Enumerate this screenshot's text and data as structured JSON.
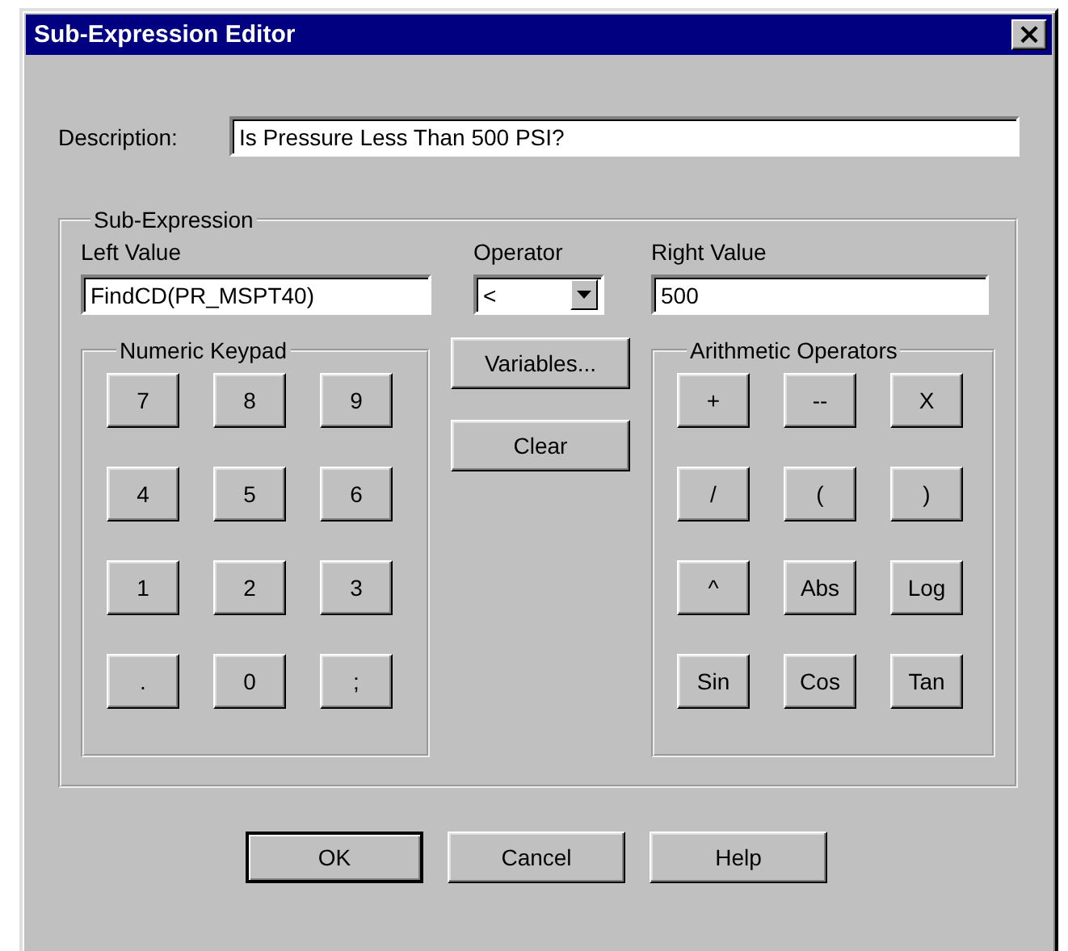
{
  "window": {
    "title": "Sub-Expression Editor",
    "close": "×"
  },
  "description": {
    "label": "Description:",
    "value": "Is Pressure Less Than 500 PSI?"
  },
  "sub_expression": {
    "title": "Sub-Expression",
    "left_value": {
      "label": "Left Value",
      "value": "FindCD(PR_MSPT40)"
    },
    "operator": {
      "label": "Operator",
      "value": "<"
    },
    "right_value": {
      "label": "Right Value",
      "value": "500"
    },
    "numeric_keypad": {
      "title": "Numeric Keypad",
      "keys": [
        "7",
        "8",
        "9",
        "4",
        "5",
        "6",
        "1",
        "2",
        "3",
        ".",
        "0",
        ";"
      ]
    },
    "middle_buttons": [
      "Variables...",
      "Clear"
    ],
    "arithmetic_operators": {
      "title": "Arithmetic Operators",
      "keys": [
        "+",
        "--",
        "X",
        "/",
        "(",
        ")",
        "^",
        "Abs",
        "Log",
        "Sin",
        "Cos",
        "Tan"
      ]
    }
  },
  "buttons": [
    {
      "label": "OK",
      "default": true
    },
    {
      "label": "Cancel",
      "default": false
    },
    {
      "label": "Help",
      "default": false
    }
  ]
}
